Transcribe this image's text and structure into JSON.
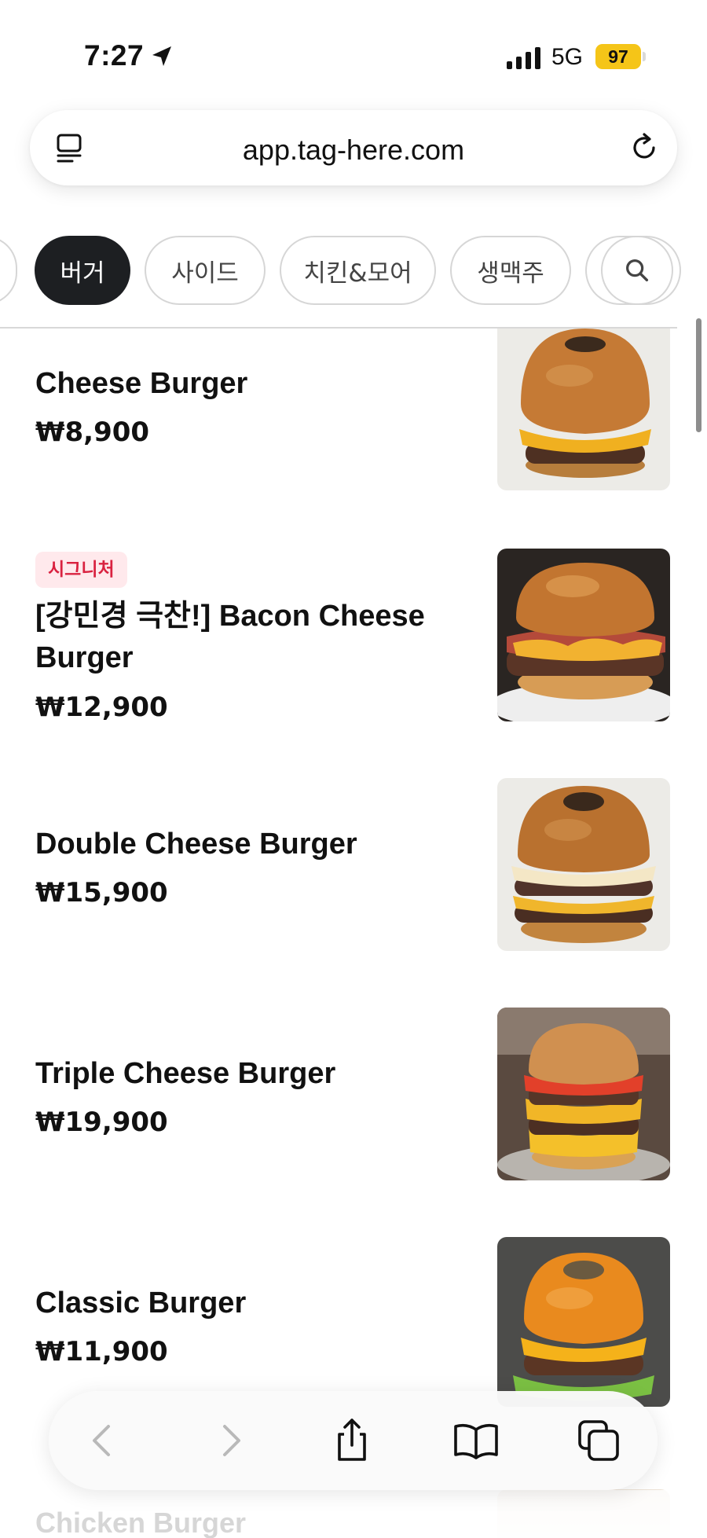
{
  "status_bar": {
    "time": "7:27",
    "network": "5G",
    "battery": "97",
    "battery_color": "#f5c518",
    "icons": [
      "location-arrow-icon",
      "cellular-signal-icon"
    ]
  },
  "browser": {
    "url": "app.tag-here.com",
    "icons": [
      "page-menu-icon",
      "reload-icon"
    ]
  },
  "categories": {
    "tabs": [
      {
        "label": "버거",
        "active": true
      },
      {
        "label": "사이드",
        "active": false
      },
      {
        "label": "치킨&모어",
        "active": false
      },
      {
        "label": "생맥주",
        "active": false
      }
    ],
    "search_icon": "search-icon"
  },
  "menu": {
    "items": [
      {
        "badge": "",
        "name": "Cheese Burger",
        "price": "₩8,900"
      },
      {
        "badge": "시그니처",
        "name": "[강민경 극찬!] Bacon Cheese Burger",
        "price": "₩12,900"
      },
      {
        "badge": "",
        "name": "Double Cheese Burger",
        "price": "₩15,900"
      },
      {
        "badge": "",
        "name": "Triple Cheese Burger",
        "price": "₩19,900"
      },
      {
        "badge": "",
        "name": "Classic Burger",
        "price": "₩11,900"
      },
      {
        "badge": "",
        "name": "Chicken Burger",
        "price": ""
      }
    ],
    "badge_color": "#d92240"
  },
  "toolbar": {
    "icons": [
      "back-icon",
      "forward-icon",
      "share-icon",
      "bookmarks-icon",
      "tabs-icon"
    ]
  },
  "colors": {
    "active_tab": "#1d1f22",
    "tab_border": "#d6d6d6"
  }
}
